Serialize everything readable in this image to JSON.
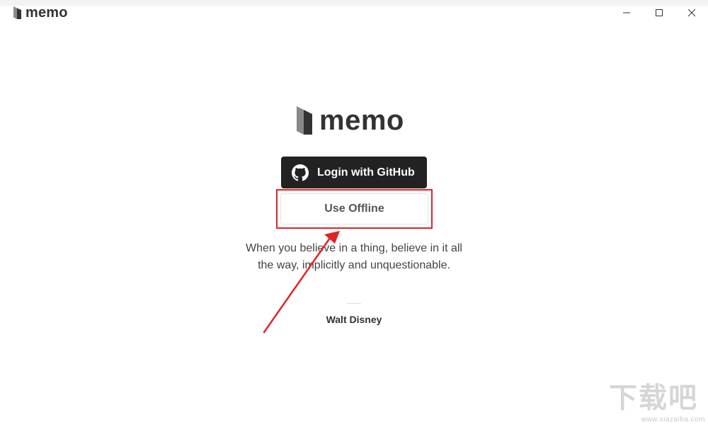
{
  "titlebar": {
    "app_name": "memo",
    "controls": [
      "minimize",
      "maximize",
      "close"
    ]
  },
  "brand": {
    "name": "memo",
    "logo_icon": "memo-logo-icon"
  },
  "login": {
    "github_label": "Login with GitHub",
    "github_icon": "github-icon",
    "offline_label": "Use Offline"
  },
  "quote": {
    "text": "When you believe in a thing, believe in it all the way, implicitly and unquestionable.",
    "author": "Walt Disney"
  },
  "annotation": {
    "highlight_color": "#e02424",
    "arrow_color": "#e02424"
  },
  "watermark": {
    "chars": "下载吧",
    "url": "www.xiazaiba.com"
  },
  "colors": {
    "github_button_bg": "#222222",
    "text_dark": "#333333"
  }
}
